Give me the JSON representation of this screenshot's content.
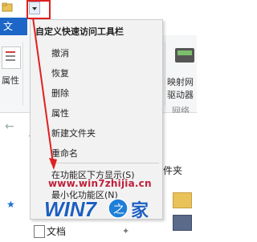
{
  "window": {
    "file_tab_label": "文",
    "ribbon_left_label": "属性",
    "ribbon_right_text_1": "映射网",
    "ribbon_right_text_2": "驱动器",
    "ribbon_right_group": "网络"
  },
  "menu": {
    "title": "自定义快速访问工具栏",
    "items": [
      {
        "label": "撤消"
      },
      {
        "label": "恢复"
      },
      {
        "label": "删除"
      },
      {
        "label": "属性"
      },
      {
        "label": "新建文件夹"
      },
      {
        "label": "重命名"
      }
    ],
    "show_below": "在功能区下方显示(S)",
    "minimize": "最小化功能区(N)"
  },
  "content": {
    "right_text": "件夹",
    "sidebar_item": "文档"
  },
  "watermark": {
    "url": "www.win7zhijia.cn",
    "logo": "WIN7之家"
  },
  "colors": {
    "accent": "#1b66c7",
    "annotation": "#e02020",
    "watermark": "#c0203a"
  }
}
